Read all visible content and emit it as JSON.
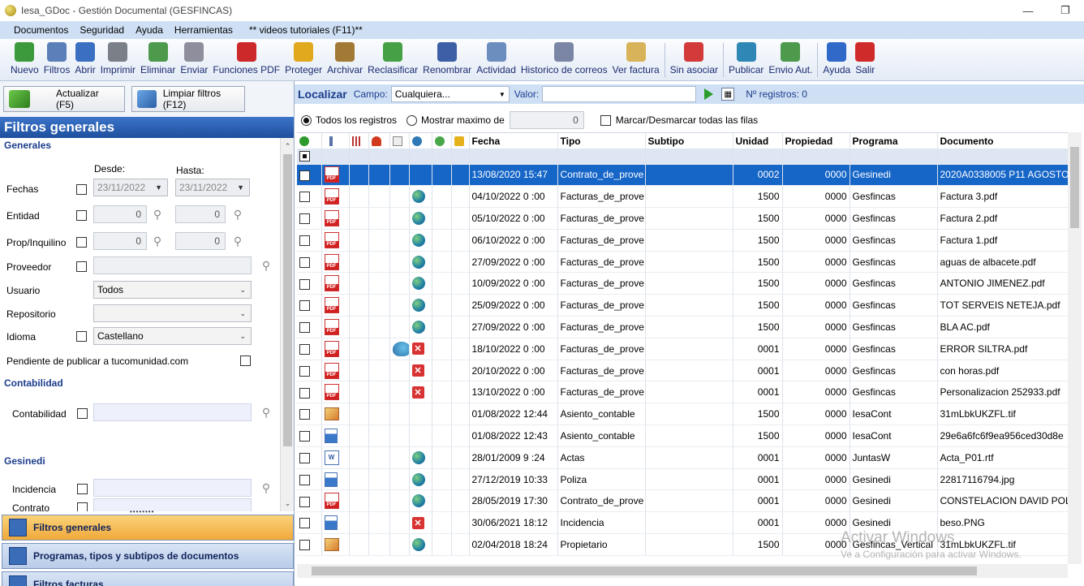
{
  "window": {
    "title": "Iesa_GDoc - Gestión Documental (GESFINCAS)",
    "minimize": "—",
    "restore": "❐"
  },
  "menu": [
    "Documentos",
    "Seguridad",
    "Ayuda",
    "Herramientas",
    "** videos tutoriales (F11)**"
  ],
  "toolbar": [
    {
      "label": "Nuevo",
      "icon": "new-doc-icon",
      "color": "#3c9a3c"
    },
    {
      "label": "Filtros",
      "icon": "magnifier-icon",
      "color": "#5b7fb8"
    },
    {
      "label": "Abrir",
      "icon": "folder-open-icon",
      "color": "#3b6fc2"
    },
    {
      "label": "Imprimir",
      "icon": "printer-icon",
      "color": "#7a7f88"
    },
    {
      "label": "Eliminar",
      "icon": "trash-icon",
      "color": "#4d9a4d"
    },
    {
      "label": "Enviar",
      "icon": "envelope-icon",
      "color": "#8e8e9c"
    },
    {
      "label": "Funciones PDF",
      "icon": "pdf-icon",
      "color": "#cc2a2a"
    },
    {
      "label": "Proteger",
      "icon": "lock-icon",
      "color": "#e0a91e"
    },
    {
      "label": "Archivar",
      "icon": "box-icon",
      "color": "#a37a35"
    },
    {
      "label": "Reclasificar",
      "icon": "reclassify-icon",
      "color": "#46a046"
    },
    {
      "label": "Renombrar",
      "icon": "save-icon",
      "color": "#3d5fa5"
    },
    {
      "label": "Actividad",
      "icon": "activity-icon",
      "color": "#6c8ebf"
    },
    {
      "label": "Historico de correos",
      "icon": "mail-history-icon",
      "color": "#7b86a6"
    },
    {
      "label": "Ver factura",
      "icon": "invoice-icon",
      "color": "#d8b35a"
    },
    {
      "label": "Sin asociar",
      "icon": "unassociated-icon",
      "color": "#d33a3a"
    },
    {
      "label": "Publicar",
      "icon": "globe-icon",
      "color": "#2f87b5"
    },
    {
      "label": "Envio Aut.",
      "icon": "upload-icon",
      "color": "#4d9a4d"
    },
    {
      "label": "Ayuda",
      "icon": "help-icon",
      "color": "#3069c7"
    },
    {
      "label": "Salir",
      "icon": "power-icon",
      "color": "#d02b2b"
    }
  ],
  "left": {
    "refresh_btn": "Actualizar (F5)",
    "clear_btn": "Limpiar filtros (F12)",
    "title": "Filtros generales",
    "sections": {
      "generales": "Generales",
      "contabilidad": "Contabilidad",
      "gesinedi": "Gesinedi"
    },
    "desde": "Desde:",
    "hasta": "Hasta:",
    "fechas": {
      "label": "Fechas",
      "from": "23/11/2022",
      "to": "23/11/2022"
    },
    "entidad": {
      "label": "Entidad",
      "from": "0",
      "to": "0"
    },
    "prop": {
      "label": "Prop/Inquilino",
      "from": "0",
      "to": "0"
    },
    "proveedor": {
      "label": "Proveedor"
    },
    "usuario": {
      "label": "Usuario",
      "value": "Todos"
    },
    "repositorio": {
      "label": "Repositorio",
      "value": ""
    },
    "idioma": {
      "label": "Idioma",
      "value": "Castellano"
    },
    "pendiente": "Pendiente de publicar a tucomunidad.com",
    "contabilidad": {
      "label": "Contabilidad"
    },
    "incidencia": {
      "label": "Incidencia"
    },
    "contrato": {
      "label": "Contrato"
    },
    "nav": [
      "Filtros generales",
      "Programas, tipos y subtipos de documentos",
      "Filtros facturas"
    ]
  },
  "search": {
    "title": "Localizar",
    "campo_label": "Campo:",
    "campo_value": "Cualquiera...",
    "valor_label": "Valor:",
    "valor_value": "",
    "nregistros": "Nº registros: 0"
  },
  "options": {
    "todos": "Todos los registros",
    "mostrar": "Mostrar maximo de",
    "maximo": "0",
    "marcar": "Marcar/Desmarcar todas las filas"
  },
  "grid": {
    "columns": [
      "Fecha",
      "Tipo",
      "Subtipo",
      "Unidad",
      "Propiedad",
      "Programa",
      "Documento"
    ],
    "rows": [
      {
        "sel": true,
        "icon": "pdf",
        "web": "",
        "fecha": "13/08/2020 15:47",
        "tipo": "Contrato_de_prove",
        "subtipo": "",
        "unidad": "0002",
        "prop": "0000",
        "programa": "Gesinedi",
        "doc": "2020A0338005 P11 AGOSTO"
      },
      {
        "sel": false,
        "icon": "pdf",
        "web": "globe",
        "fecha": "04/10/2022 0 :00",
        "tipo": "Facturas_de_prove",
        "subtipo": "",
        "unidad": "1500",
        "prop": "0000",
        "programa": "Gesfincas",
        "doc": "Factura 3.pdf"
      },
      {
        "sel": false,
        "icon": "pdf",
        "web": "globe",
        "fecha": "05/10/2022 0 :00",
        "tipo": "Facturas_de_prove",
        "subtipo": "",
        "unidad": "1500",
        "prop": "0000",
        "programa": "Gesfincas",
        "doc": "Factura 2.pdf"
      },
      {
        "sel": false,
        "icon": "pdf",
        "web": "globe",
        "fecha": "06/10/2022 0 :00",
        "tipo": "Facturas_de_prove",
        "subtipo": "",
        "unidad": "1500",
        "prop": "0000",
        "programa": "Gesfincas",
        "doc": "Factura 1.pdf"
      },
      {
        "sel": false,
        "icon": "pdf",
        "web": "globe",
        "fecha": "27/09/2022 0 :00",
        "tipo": "Facturas_de_prove",
        "subtipo": "",
        "unidad": "1500",
        "prop": "0000",
        "programa": "Gesfincas",
        "doc": "aguas de albacete.pdf"
      },
      {
        "sel": false,
        "icon": "pdf",
        "web": "globe",
        "fecha": "10/09/2022 0 :00",
        "tipo": "Facturas_de_prove",
        "subtipo": "",
        "unidad": "1500",
        "prop": "0000",
        "programa": "Gesfincas",
        "doc": "ANTONIO JIMENEZ.pdf"
      },
      {
        "sel": false,
        "icon": "pdf",
        "web": "globe",
        "fecha": "25/09/2022 0 :00",
        "tipo": "Facturas_de_prove",
        "subtipo": "",
        "unidad": "1500",
        "prop": "0000",
        "programa": "Gesfincas",
        "doc": "TOT SERVEIS NETEJA.pdf"
      },
      {
        "sel": false,
        "icon": "pdf",
        "web": "globe",
        "fecha": "27/09/2022 0 :00",
        "tipo": "Facturas_de_prove",
        "subtipo": "",
        "unidad": "1500",
        "prop": "0000",
        "programa": "Gesfincas",
        "doc": "BLA AC.pdf"
      },
      {
        "sel": false,
        "icon": "pdf",
        "web": "redx",
        "mail": true,
        "fecha": "18/10/2022 0 :00",
        "tipo": "Facturas_de_prove",
        "subtipo": "",
        "unidad": "0001",
        "prop": "0000",
        "programa": "Gesfincas",
        "doc": "ERROR SILTRA.pdf"
      },
      {
        "sel": false,
        "icon": "pdf",
        "web": "redx",
        "fecha": "20/10/2022 0 :00",
        "tipo": "Facturas_de_prove",
        "subtipo": "",
        "unidad": "0001",
        "prop": "0000",
        "programa": "Gesfincas",
        "doc": "con horas.pdf"
      },
      {
        "sel": false,
        "icon": "pdf",
        "web": "redx",
        "fecha": "13/10/2022 0 :00",
        "tipo": "Facturas_de_prove",
        "subtipo": "",
        "unidad": "0001",
        "prop": "0000",
        "programa": "Gesfincas",
        "doc": "Personalizacion 252933.pdf"
      },
      {
        "sel": false,
        "icon": "asiento",
        "web": "",
        "fecha": "01/08/2022 12:44",
        "tipo": "Asiento_contable",
        "subtipo": "",
        "unidad": "1500",
        "prop": "0000",
        "programa": "IesaCont",
        "doc": "31mLbkUKZFL.tif"
      },
      {
        "sel": false,
        "icon": "img",
        "web": "",
        "fecha": "01/08/2022 12:43",
        "tipo": "Asiento_contable",
        "subtipo": "",
        "unidad": "1500",
        "prop": "0000",
        "programa": "IesaCont",
        "doc": "29e6a6fc6f9ea956ced30d8e"
      },
      {
        "sel": false,
        "icon": "doc",
        "web": "globe",
        "fecha": "28/01/2009 9 :24",
        "tipo": "Actas",
        "subtipo": "",
        "unidad": "0001",
        "prop": "0000",
        "programa": "JuntasW",
        "doc": "Acta_P01.rtf"
      },
      {
        "sel": false,
        "icon": "img",
        "web": "globe",
        "fecha": "27/12/2019 10:33",
        "tipo": "Poliza",
        "subtipo": "",
        "unidad": "0001",
        "prop": "0000",
        "programa": "Gesinedi",
        "doc": "22817116794.jpg"
      },
      {
        "sel": false,
        "icon": "pdf",
        "web": "globe",
        "fecha": "28/05/2019 17:30",
        "tipo": "Contrato_de_prove",
        "subtipo": "",
        "unidad": "0001",
        "prop": "0000",
        "programa": "Gesinedi",
        "doc": "CONSTELACION DAVID POL"
      },
      {
        "sel": false,
        "icon": "img",
        "web": "redx",
        "fecha": "30/06/2021 18:12",
        "tipo": "Incidencia",
        "subtipo": "",
        "unidad": "0001",
        "prop": "0000",
        "programa": "Gesinedi",
        "doc": "beso.PNG"
      },
      {
        "sel": false,
        "icon": "asiento",
        "web": "globe",
        "fecha": "02/04/2018 18:24",
        "tipo": "Propietario",
        "subtipo": "",
        "unidad": "1500",
        "prop": "0000",
        "programa": "Gesfincas_Vertical",
        "doc": "31mLbkUKZFL.tif"
      }
    ]
  },
  "watermark": {
    "line1": "Activar Windows",
    "line2": "Ve a Configuración para activar Windows."
  }
}
